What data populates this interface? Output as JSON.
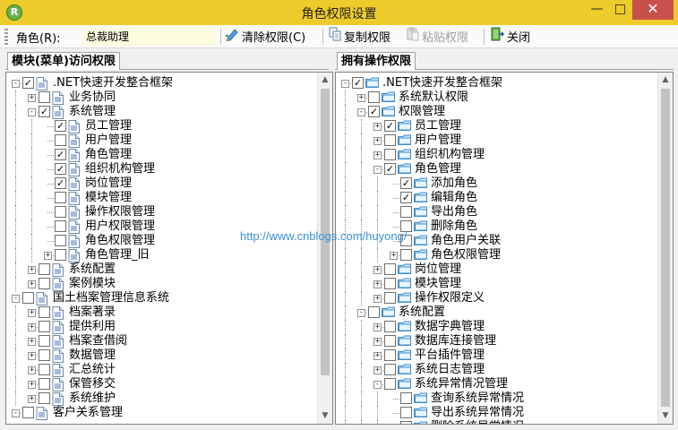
{
  "window": {
    "title": "角色权限设置",
    "app_icon": "R",
    "controls": {
      "minimize": "—",
      "maximize": "□",
      "close": "✕"
    }
  },
  "toolbar": {
    "role_label": "角色(R):",
    "role_value": "总裁助理",
    "clear_label": "清除权限(C)",
    "copy_label": "复制权限",
    "paste_label": "粘贴权限",
    "close_label": "关闭"
  },
  "left_panel": {
    "tab_label": "模块(菜单)访问权限",
    "nodes": [
      {
        "label": ".NET快速开发整合框架",
        "level": 0,
        "expander": "-",
        "checked": true,
        "icon": "doc"
      },
      {
        "label": "业务协同",
        "level": 1,
        "expander": "+",
        "checked": false,
        "icon": "doc"
      },
      {
        "label": "系统管理",
        "level": 1,
        "expander": "-",
        "checked": true,
        "icon": "doc"
      },
      {
        "label": "员工管理",
        "level": 2,
        "expander": "",
        "checked": true,
        "icon": "doc"
      },
      {
        "label": "用户管理",
        "level": 2,
        "expander": "",
        "checked": false,
        "icon": "doc"
      },
      {
        "label": "角色管理",
        "level": 2,
        "expander": "",
        "checked": true,
        "icon": "doc"
      },
      {
        "label": "组织机构管理",
        "level": 2,
        "expander": "",
        "checked": true,
        "icon": "doc"
      },
      {
        "label": "岗位管理",
        "level": 2,
        "expander": "",
        "checked": true,
        "icon": "doc"
      },
      {
        "label": "模块管理",
        "level": 2,
        "expander": "",
        "checked": false,
        "icon": "doc"
      },
      {
        "label": "操作权限管理",
        "level": 2,
        "expander": "",
        "checked": false,
        "icon": "doc"
      },
      {
        "label": "用户权限管理",
        "level": 2,
        "expander": "",
        "checked": false,
        "icon": "doc"
      },
      {
        "label": "角色权限管理",
        "level": 2,
        "expander": "",
        "checked": false,
        "icon": "doc"
      },
      {
        "label": "角色管理_旧",
        "level": 2,
        "expander": "+",
        "checked": false,
        "icon": "doc"
      },
      {
        "label": "系统配置",
        "level": 1,
        "expander": "+",
        "checked": false,
        "icon": "doc"
      },
      {
        "label": "案例模块",
        "level": 1,
        "expander": "+",
        "checked": false,
        "icon": "doc"
      },
      {
        "label": "国土档案管理信息系统",
        "level": 0,
        "expander": "-",
        "checked": false,
        "icon": "doc"
      },
      {
        "label": "档案著录",
        "level": 1,
        "expander": "+",
        "checked": false,
        "icon": "doc"
      },
      {
        "label": "提供利用",
        "level": 1,
        "expander": "+",
        "checked": false,
        "icon": "doc"
      },
      {
        "label": "档案查借阅",
        "level": 1,
        "expander": "+",
        "checked": false,
        "icon": "doc"
      },
      {
        "label": "数据管理",
        "level": 1,
        "expander": "+",
        "checked": false,
        "icon": "doc"
      },
      {
        "label": "汇总统计",
        "level": 1,
        "expander": "+",
        "checked": false,
        "icon": "doc"
      },
      {
        "label": "保管移交",
        "level": 1,
        "expander": "+",
        "checked": false,
        "icon": "doc"
      },
      {
        "label": "系统维护",
        "level": 1,
        "expander": "+",
        "checked": false,
        "icon": "doc"
      },
      {
        "label": "客户关系管理",
        "level": 0,
        "expander": "-",
        "checked": false,
        "icon": "doc"
      }
    ]
  },
  "right_panel": {
    "tab_label": "拥有操作权限",
    "nodes": [
      {
        "label": ".NET快速开发整合框架",
        "level": 0,
        "expander": "-",
        "checked": true,
        "icon": "folder"
      },
      {
        "label": "系统默认权限",
        "level": 1,
        "expander": "+",
        "checked": false,
        "icon": "folder"
      },
      {
        "label": "权限管理",
        "level": 1,
        "expander": "-",
        "checked": true,
        "icon": "folder"
      },
      {
        "label": "员工管理",
        "level": 2,
        "expander": "+",
        "checked": true,
        "icon": "folder"
      },
      {
        "label": "用户管理",
        "level": 2,
        "expander": "+",
        "checked": false,
        "icon": "folder"
      },
      {
        "label": "组织机构管理",
        "level": 2,
        "expander": "+",
        "checked": false,
        "icon": "folder"
      },
      {
        "label": "角色管理",
        "level": 2,
        "expander": "-",
        "checked": true,
        "icon": "folder"
      },
      {
        "label": "添加角色",
        "level": 3,
        "expander": "",
        "checked": true,
        "icon": "folder"
      },
      {
        "label": "编辑角色",
        "level": 3,
        "expander": "",
        "checked": true,
        "icon": "folder"
      },
      {
        "label": "导出角色",
        "level": 3,
        "expander": "",
        "checked": false,
        "icon": "folder"
      },
      {
        "label": "删除角色",
        "level": 3,
        "expander": "",
        "checked": false,
        "icon": "folder"
      },
      {
        "label": "角色用户关联",
        "level": 3,
        "expander": "",
        "checked": false,
        "icon": "folder"
      },
      {
        "label": "角色权限管理",
        "level": 3,
        "expander": "+",
        "checked": false,
        "icon": "folder"
      },
      {
        "label": "岗位管理",
        "level": 2,
        "expander": "+",
        "checked": false,
        "icon": "folder"
      },
      {
        "label": "模块管理",
        "level": 2,
        "expander": "+",
        "checked": false,
        "icon": "folder"
      },
      {
        "label": "操作权限定义",
        "level": 2,
        "expander": "+",
        "checked": false,
        "icon": "folder"
      },
      {
        "label": "系统配置",
        "level": 1,
        "expander": "-",
        "checked": false,
        "icon": "folder"
      },
      {
        "label": "数据字典管理",
        "level": 2,
        "expander": "+",
        "checked": false,
        "icon": "folder"
      },
      {
        "label": "数据库连接管理",
        "level": 2,
        "expander": "+",
        "checked": false,
        "icon": "folder"
      },
      {
        "label": "平台插件管理",
        "level": 2,
        "expander": "+",
        "checked": false,
        "icon": "folder"
      },
      {
        "label": "系统日志管理",
        "level": 2,
        "expander": "+",
        "checked": false,
        "icon": "folder"
      },
      {
        "label": "系统异常情况管理",
        "level": 2,
        "expander": "-",
        "checked": false,
        "icon": "folder"
      },
      {
        "label": "查询系统异常情况",
        "level": 3,
        "expander": "",
        "checked": false,
        "icon": "folder"
      },
      {
        "label": "导出系统异常情况",
        "level": 3,
        "expander": "",
        "checked": false,
        "icon": "folder"
      },
      {
        "label": "删除系统异常情况",
        "level": 3,
        "expander": "",
        "checked": false,
        "icon": "folder"
      }
    ]
  },
  "watermark": "http://www.cnblogs.com/huyong/",
  "colors": {
    "title_bar": "#eccb2a",
    "close_button": "#c7504b",
    "role_field_bg": "#fdfbe0",
    "watermark": "#3d8fd8"
  }
}
